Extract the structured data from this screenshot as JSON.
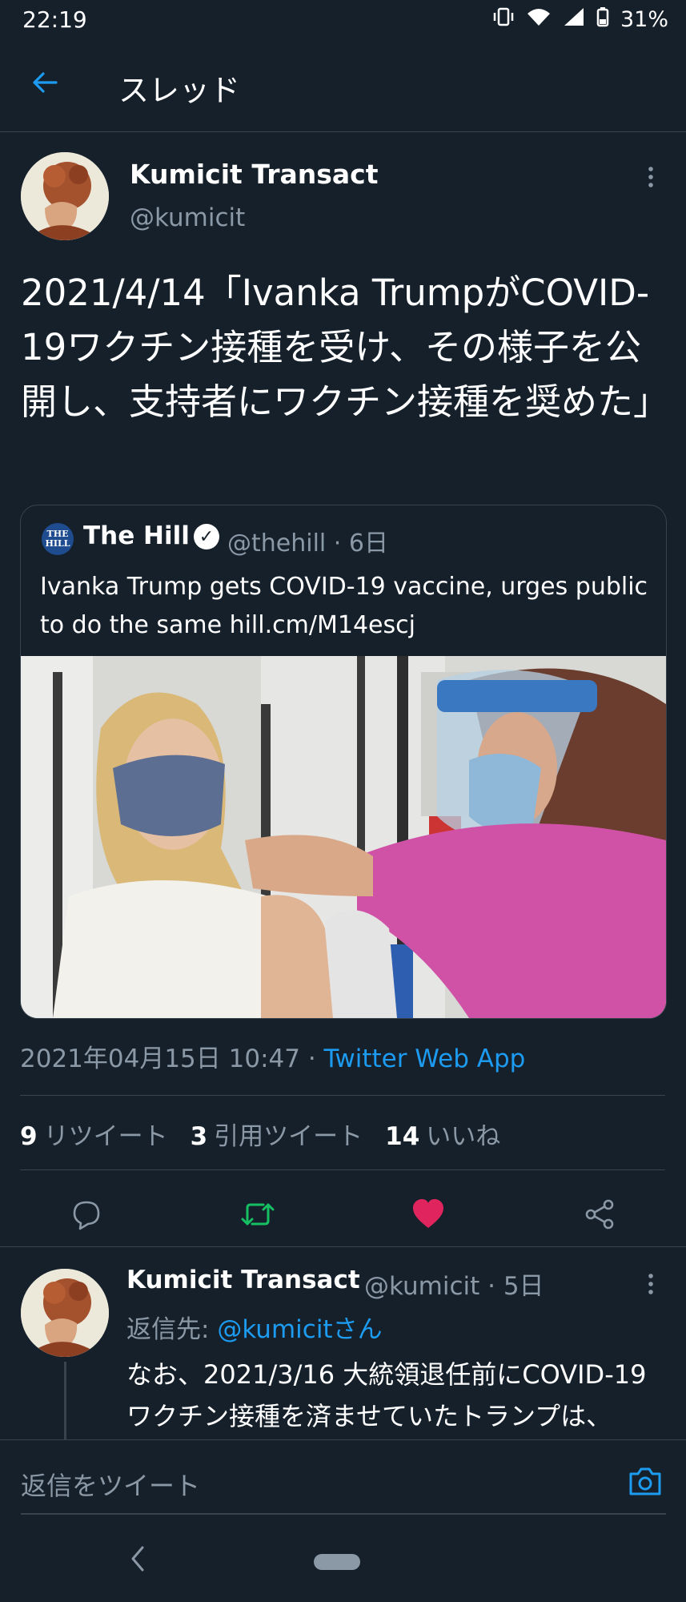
{
  "status_bar": {
    "time": "22:19",
    "battery": "31%"
  },
  "header": {
    "title": "スレッド"
  },
  "tweet": {
    "author_name": "Kumicit Transact",
    "author_handle": "@kumicit",
    "text": "2021/4/14「Ivanka TrumpがCOVID-19ワクチン接種を受け、その様子を公開し、支持者にワクチン接種を奨めた」",
    "quote": {
      "logo_text": "THE HILL",
      "name": "The Hill",
      "meta": "@thehill · 6日",
      "text": "Ivanka Trump gets COVID-19 vaccine, urges public to do the same hill.cm/M14escj"
    },
    "timestamp": "2021年04月15日 10:47 · ",
    "source": "Twitter Web App",
    "stats": {
      "retweets_count": "9",
      "retweets_label": "リツイート",
      "quotes_count": "3",
      "quotes_label": "引用ツイート",
      "likes_count": "14",
      "likes_label": "いいね"
    },
    "colors": {
      "retweet": "#17bf63",
      "like": "#e0245e"
    }
  },
  "reply": {
    "author_name": "Kumicit Transact",
    "meta": "@kumicit · 5日",
    "reply_to_prefix": "返信先: ",
    "reply_to_handle": "@kumicitさん",
    "text": "なお、2021/3/16 大統領退任前にCOVID-19ワクチン接種を済ませていたトランプは、FOXテレビで、支持者に自"
  },
  "compose": {
    "placeholder": "返信をツイート"
  }
}
